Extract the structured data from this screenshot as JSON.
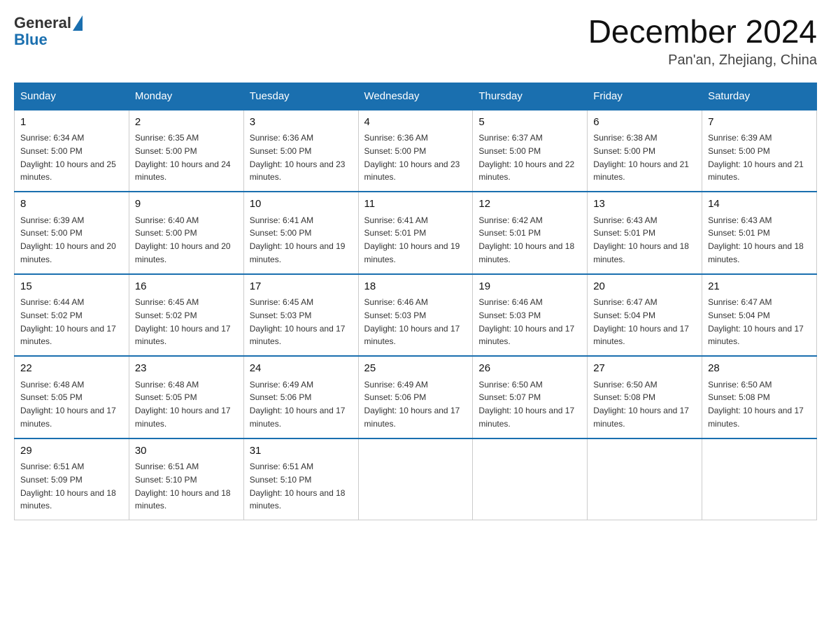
{
  "header": {
    "logo_general": "General",
    "logo_blue": "Blue",
    "title": "December 2024",
    "location": "Pan'an, Zhejiang, China"
  },
  "days_of_week": [
    "Sunday",
    "Monday",
    "Tuesday",
    "Wednesday",
    "Thursday",
    "Friday",
    "Saturday"
  ],
  "weeks": [
    [
      {
        "day": "1",
        "sunrise": "6:34 AM",
        "sunset": "5:00 PM",
        "daylight": "10 hours and 25 minutes."
      },
      {
        "day": "2",
        "sunrise": "6:35 AM",
        "sunset": "5:00 PM",
        "daylight": "10 hours and 24 minutes."
      },
      {
        "day": "3",
        "sunrise": "6:36 AM",
        "sunset": "5:00 PM",
        "daylight": "10 hours and 23 minutes."
      },
      {
        "day": "4",
        "sunrise": "6:36 AM",
        "sunset": "5:00 PM",
        "daylight": "10 hours and 23 minutes."
      },
      {
        "day": "5",
        "sunrise": "6:37 AM",
        "sunset": "5:00 PM",
        "daylight": "10 hours and 22 minutes."
      },
      {
        "day": "6",
        "sunrise": "6:38 AM",
        "sunset": "5:00 PM",
        "daylight": "10 hours and 21 minutes."
      },
      {
        "day": "7",
        "sunrise": "6:39 AM",
        "sunset": "5:00 PM",
        "daylight": "10 hours and 21 minutes."
      }
    ],
    [
      {
        "day": "8",
        "sunrise": "6:39 AM",
        "sunset": "5:00 PM",
        "daylight": "10 hours and 20 minutes."
      },
      {
        "day": "9",
        "sunrise": "6:40 AM",
        "sunset": "5:00 PM",
        "daylight": "10 hours and 20 minutes."
      },
      {
        "day": "10",
        "sunrise": "6:41 AM",
        "sunset": "5:00 PM",
        "daylight": "10 hours and 19 minutes."
      },
      {
        "day": "11",
        "sunrise": "6:41 AM",
        "sunset": "5:01 PM",
        "daylight": "10 hours and 19 minutes."
      },
      {
        "day": "12",
        "sunrise": "6:42 AM",
        "sunset": "5:01 PM",
        "daylight": "10 hours and 18 minutes."
      },
      {
        "day": "13",
        "sunrise": "6:43 AM",
        "sunset": "5:01 PM",
        "daylight": "10 hours and 18 minutes."
      },
      {
        "day": "14",
        "sunrise": "6:43 AM",
        "sunset": "5:01 PM",
        "daylight": "10 hours and 18 minutes."
      }
    ],
    [
      {
        "day": "15",
        "sunrise": "6:44 AM",
        "sunset": "5:02 PM",
        "daylight": "10 hours and 17 minutes."
      },
      {
        "day": "16",
        "sunrise": "6:45 AM",
        "sunset": "5:02 PM",
        "daylight": "10 hours and 17 minutes."
      },
      {
        "day": "17",
        "sunrise": "6:45 AM",
        "sunset": "5:03 PM",
        "daylight": "10 hours and 17 minutes."
      },
      {
        "day": "18",
        "sunrise": "6:46 AM",
        "sunset": "5:03 PM",
        "daylight": "10 hours and 17 minutes."
      },
      {
        "day": "19",
        "sunrise": "6:46 AM",
        "sunset": "5:03 PM",
        "daylight": "10 hours and 17 minutes."
      },
      {
        "day": "20",
        "sunrise": "6:47 AM",
        "sunset": "5:04 PM",
        "daylight": "10 hours and 17 minutes."
      },
      {
        "day": "21",
        "sunrise": "6:47 AM",
        "sunset": "5:04 PM",
        "daylight": "10 hours and 17 minutes."
      }
    ],
    [
      {
        "day": "22",
        "sunrise": "6:48 AM",
        "sunset": "5:05 PM",
        "daylight": "10 hours and 17 minutes."
      },
      {
        "day": "23",
        "sunrise": "6:48 AM",
        "sunset": "5:05 PM",
        "daylight": "10 hours and 17 minutes."
      },
      {
        "day": "24",
        "sunrise": "6:49 AM",
        "sunset": "5:06 PM",
        "daylight": "10 hours and 17 minutes."
      },
      {
        "day": "25",
        "sunrise": "6:49 AM",
        "sunset": "5:06 PM",
        "daylight": "10 hours and 17 minutes."
      },
      {
        "day": "26",
        "sunrise": "6:50 AM",
        "sunset": "5:07 PM",
        "daylight": "10 hours and 17 minutes."
      },
      {
        "day": "27",
        "sunrise": "6:50 AM",
        "sunset": "5:08 PM",
        "daylight": "10 hours and 17 minutes."
      },
      {
        "day": "28",
        "sunrise": "6:50 AM",
        "sunset": "5:08 PM",
        "daylight": "10 hours and 17 minutes."
      }
    ],
    [
      {
        "day": "29",
        "sunrise": "6:51 AM",
        "sunset": "5:09 PM",
        "daylight": "10 hours and 18 minutes."
      },
      {
        "day": "30",
        "sunrise": "6:51 AM",
        "sunset": "5:10 PM",
        "daylight": "10 hours and 18 minutes."
      },
      {
        "day": "31",
        "sunrise": "6:51 AM",
        "sunset": "5:10 PM",
        "daylight": "10 hours and 18 minutes."
      },
      null,
      null,
      null,
      null
    ]
  ]
}
